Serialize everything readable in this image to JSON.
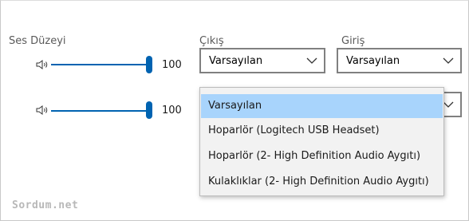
{
  "volume_section": {
    "label": "Ses Düzeyi",
    "sliders": [
      {
        "value": 100,
        "value_text": "100",
        "icon": "speaker-icon"
      },
      {
        "value": 100,
        "value_text": "100",
        "icon": "speaker-icon"
      }
    ]
  },
  "output": {
    "label": "Çıkış",
    "selected": "Varsayılan"
  },
  "input": {
    "label": "Giriş",
    "selected": "Varsayılan"
  },
  "dropdown": {
    "options": [
      "Varsayılan",
      "Hoparlör (Logitech USB Headset)",
      "Hoparlör (2- High Definition Audio Aygıtı)",
      "Kulaklıklar (2- High Definition Audio Aygıtı)"
    ],
    "selected_index": 0
  },
  "watermark": "Sordum.net",
  "colors": {
    "accent": "#0063b1",
    "selection": "#a8d4fc",
    "dropdown_bg": "#f2f2f2"
  }
}
